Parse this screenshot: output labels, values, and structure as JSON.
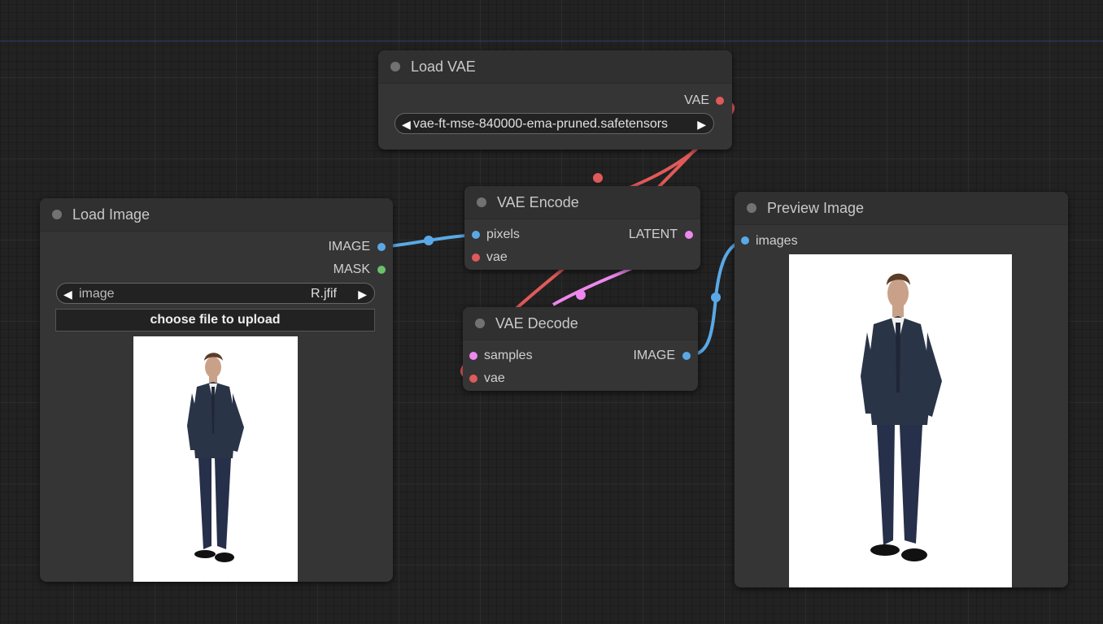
{
  "colors": {
    "image_link": "#5aa9e6",
    "vae_link": "#e05a5a",
    "latent_link": "#ee88ee",
    "mask_port": "#6bc06b"
  },
  "nodes": {
    "load_vae": {
      "title": "Load VAE",
      "output_vae": "VAE",
      "vae_name_value": "vae-ft-mse-840000-ema-pruned.safetensors"
    },
    "load_image": {
      "title": "Load Image",
      "output_image": "IMAGE",
      "output_mask": "MASK",
      "image_widget_label": "image",
      "image_widget_value": "R.jfif",
      "upload_button": "choose file to upload"
    },
    "vae_encode": {
      "title": "VAE Encode",
      "input_pixels": "pixels",
      "input_vae": "vae",
      "output_latent": "LATENT"
    },
    "vae_decode": {
      "title": "VAE Decode",
      "input_samples": "samples",
      "input_vae": "vae",
      "output_image": "IMAGE"
    },
    "preview_image": {
      "title": "Preview Image",
      "input_images": "images"
    }
  }
}
